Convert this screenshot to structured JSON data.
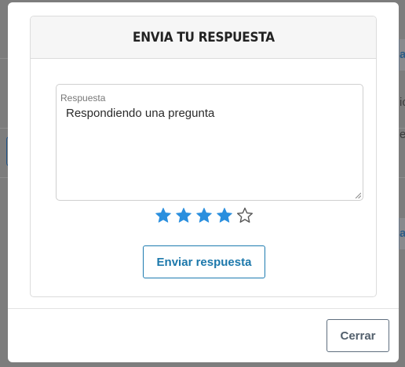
{
  "background": {
    "fragments": [
      "a",
      "ic",
      "e",
      "a"
    ]
  },
  "modal": {
    "title": "ENVIA TU RESPUESTA",
    "field": {
      "label": "Respuesta",
      "value": "Respondiendo una pregunta"
    },
    "rating": {
      "value": 4,
      "max": 5,
      "filled_color": "#2a8fde",
      "empty_color": "#555555"
    },
    "submit_label": "Enviar respuesta",
    "close_label": "Cerrar"
  }
}
